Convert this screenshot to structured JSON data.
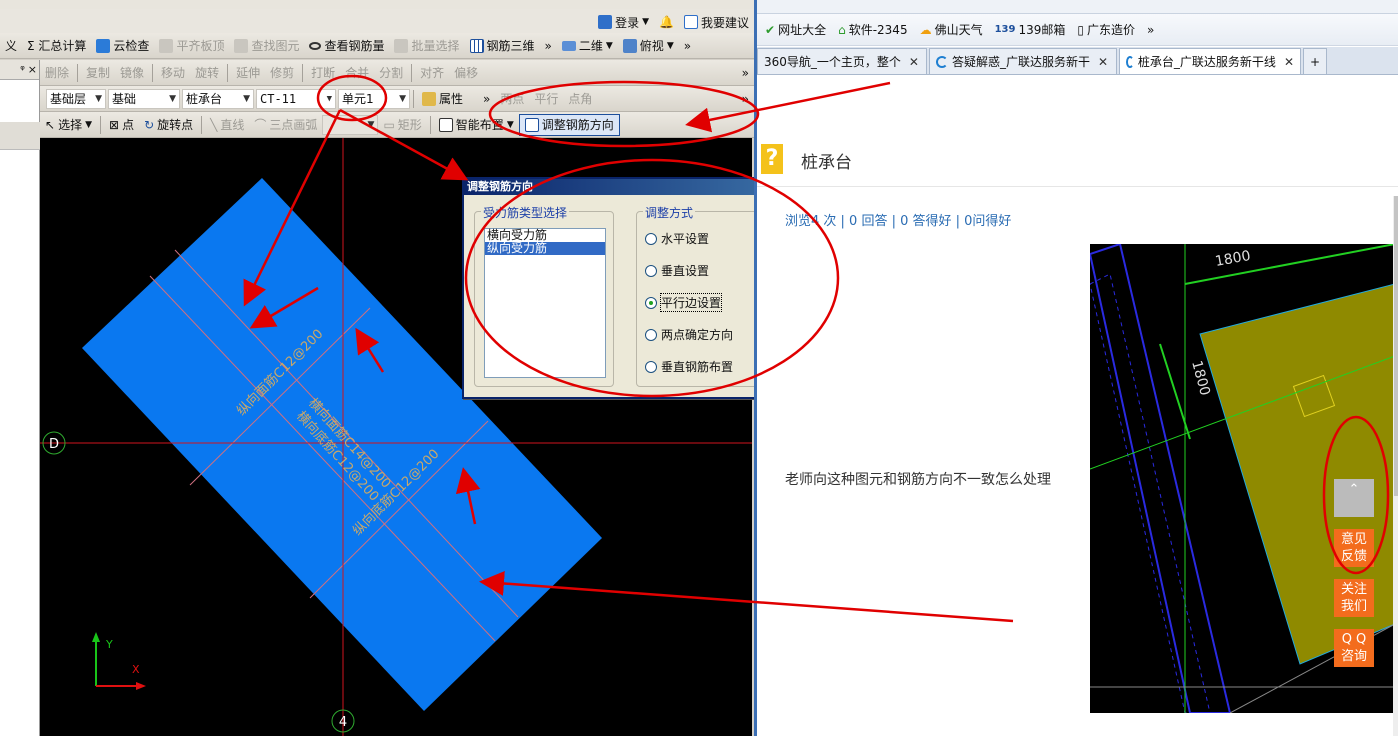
{
  "cad": {
    "login_bar": {
      "login": "登录",
      "suggest": "我要建议"
    },
    "toolbar1": {
      "items": [
        "义",
        "Σ 汇总计算",
        "云检查",
        "平齐板顶",
        "查找图元",
        "查看钢筋量",
        "批量选择",
        "钢筋三维",
        "二维",
        "俯视"
      ],
      "more": "»"
    },
    "toolbar2": {
      "items": [
        "删除",
        "复制",
        "镜像",
        "移动",
        "旋转",
        "延伸",
        "修剪",
        "打断",
        "合并",
        "分割",
        "对齐",
        "偏移"
      ],
      "more": "»"
    },
    "toolbar3": {
      "floor": "基础层",
      "category": "基础",
      "type": "桩承台",
      "element": "CT-11",
      "unit": "单元1",
      "property": "属性",
      "extra": [
        "两点",
        "平行",
        "点角"
      ],
      "more": "»"
    },
    "toolbar4": {
      "select": "选择",
      "point": "点",
      "rotate_point": "旋转点",
      "line": "直线",
      "three_arc": "三点画弧",
      "rect": "矩形",
      "smart": "智能布置",
      "adjust": "调整钢筋方向"
    },
    "left_panel": {
      "pin": "ᵠ",
      "close": "×"
    },
    "canvas": {
      "labels": {
        "rebar_top_1": "纵向面筋C12@200",
        "rebar_horiz_top": "横向面筋C14@200",
        "rebar_horiz_bottom": "横向底筋C12@200",
        "rebar_bottom_2": "纵向底筋C12@200"
      },
      "axis_d": "D",
      "axis_4": "4",
      "axis_y": "Y",
      "axis_x": "X"
    },
    "dialog": {
      "title": "调整钢筋方向",
      "group1": "受力筋类型选择",
      "list": [
        "横向受力筋",
        "纵向受力筋"
      ],
      "selected_index": 1,
      "group2": "调整方式",
      "radios": [
        "水平设置",
        "垂直设置",
        "平行边设置",
        "两点确定方向",
        "垂直钢筋布置"
      ],
      "checked_index": 2
    }
  },
  "browser": {
    "bookmarks": [
      "网址大全",
      "软件-2345",
      "佛山天气",
      "139邮箱",
      "广东造价"
    ],
    "tabs": [
      {
        "label": "360导航_一个主页，整个",
        "active": false
      },
      {
        "label": "答疑解惑_广联达服务新干",
        "active": false
      },
      {
        "label": "桩承台_广联达服务新干线",
        "active": true
      }
    ],
    "question_title": "桩承台",
    "stats": "浏览4 次 | 0 回答 | 0 答得好 | 0问得好",
    "question_text": "老师向这种图元和钢筋方向不一致怎么处理",
    "image_labels": {
      "dim1": "1800",
      "dim2": "1800"
    },
    "side_buttons": [
      {
        "label1": "意见",
        "label2": "反馈"
      },
      {
        "label1": "关注",
        "label2": "我们"
      },
      {
        "label1": "Q Q",
        "label2": "咨询"
      }
    ]
  },
  "colors": {
    "slab_blue": "#0a78f0",
    "annotation_red": "#e00000",
    "dialog_title": "#0a246a",
    "accent_orange": "#f36c1d"
  }
}
